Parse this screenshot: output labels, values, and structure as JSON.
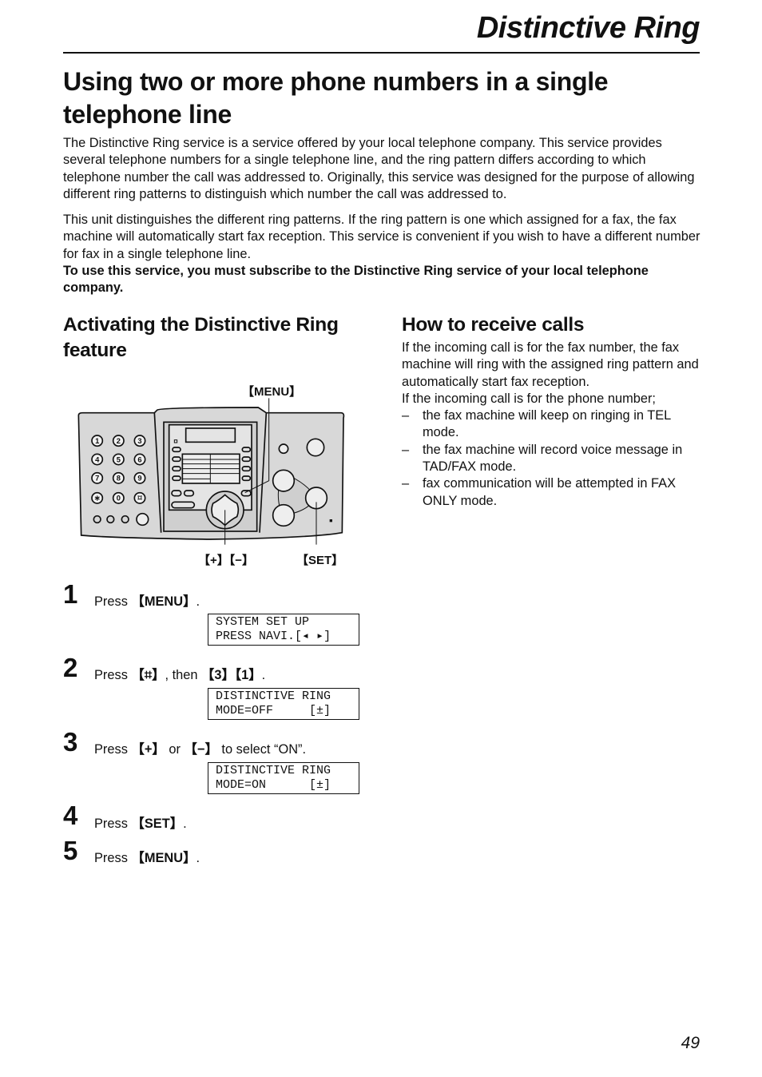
{
  "header": {
    "title": "Distinctive Ring",
    "page_number": "49"
  },
  "main_title": "Using two or more phone numbers in a single telephone line",
  "intro": {
    "p1": "The Distinctive Ring service is a service offered by your local telephone company. This service provides several telephone numbers for a single telephone line, and the ring pattern differs according to which telephone number the call was addressed to. Originally, this service was designed for the purpose of allowing different ring patterns to distinguish which number the call was addressed to.",
    "p2": "This unit distinguishes the different ring patterns. If the ring pattern is one which assigned for a fax, the fax machine will automatically start fax reception. This service is convenient if you wish to have a different number for fax in a single telephone line.",
    "p3_bold": "To use this service, you must subscribe to the Distinctive Ring service of your local telephone company."
  },
  "left": {
    "heading": "Activating the Distinctive Ring feature",
    "diagram": {
      "label_menu": "【MENU】",
      "label_plusminus": "【+】【−】",
      "label_set": "【SET】",
      "keypad": [
        "1",
        "2",
        "3",
        "4",
        "5",
        "6",
        "7",
        "8",
        "9",
        "∗",
        "0",
        "⌑"
      ]
    },
    "steps": [
      {
        "num": "1",
        "pre": "Press ",
        "key": "【MENU】",
        "post": ".",
        "lcd": "SYSTEM SET UP\nPRESS NAVI.[◂ ▸]"
      },
      {
        "num": "2",
        "pre": "Press ",
        "key": "【⌗】",
        "post": ", then ",
        "key2": "【3】【1】",
        "post2": ".",
        "lcd": "DISTINCTIVE RING\nMODE=OFF     [±]"
      },
      {
        "num": "3",
        "pre": "Press ",
        "key": "【+】",
        "post": " or ",
        "key2": "【−】",
        "post2": " to select “ON”.",
        "lcd": "DISTINCTIVE RING\nMODE=ON      [±]"
      },
      {
        "num": "4",
        "pre": "Press ",
        "key": "【SET】",
        "post": "."
      },
      {
        "num": "5",
        "pre": "Press ",
        "key": "【MENU】",
        "post": "."
      }
    ]
  },
  "right": {
    "heading": "How to receive calls",
    "p1": "If the incoming call is for the fax number, the fax machine will ring with the assigned ring pattern and automatically start fax reception.",
    "p2": "If the incoming call is for the phone number;",
    "bullets": [
      "the fax machine will keep on ringing in TEL mode.",
      "the fax machine will record voice message in TAD/FAX mode.",
      "fax communication will be attempted in FAX ONLY mode."
    ],
    "bullet_marker": "–"
  }
}
